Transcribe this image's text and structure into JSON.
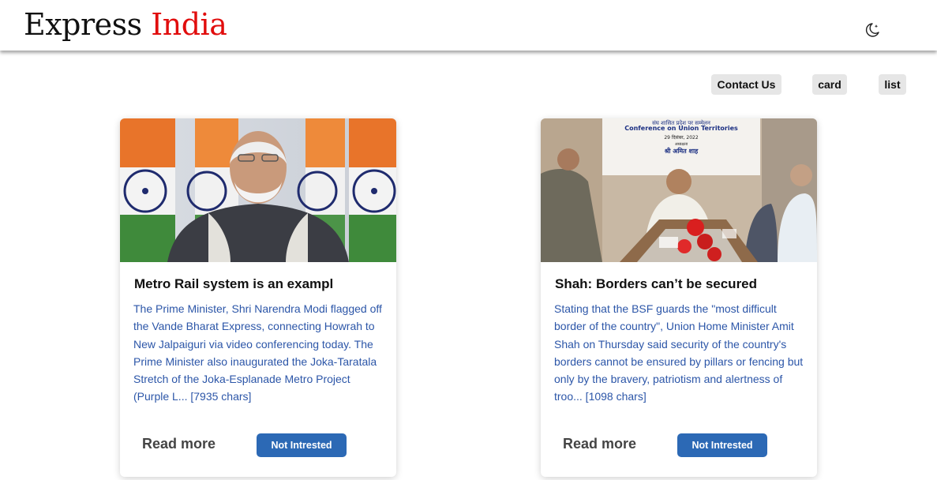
{
  "header": {
    "brand_main": "Express",
    "brand_accent": "India",
    "theme_toggle_icon": "moon-star-icon"
  },
  "nav": {
    "contact_label": "Contact Us",
    "card_label": "card",
    "list_label": "list"
  },
  "cards": [
    {
      "title": "Metro Rail system is an exampl",
      "description": "The Prime Minister, Shri Narendra Modi flagged off the Vande Bharat Express, connecting Howrah to New Jalpaiguri via video conferencing today. The Prime Minister also inaugurated the Joka-Taratala Stretch of the Joka-Esplanade Metro Project (Purple L... [7935 chars]",
      "read_more": "Read more",
      "not_interested": "Not Intrested"
    },
    {
      "title": "Shah: Borders can’t be secured",
      "description": "Stating that the BSF guards the \"most difficult border of the country\", Union Home Minister Amit Shah on Thursday said security of the country's borders cannot be ensured by pillars or fencing but only by the bravery, patriotism and alertness of troo... [1098 chars]",
      "read_more": "Read more",
      "not_interested": "Not Intrested",
      "image_banner": {
        "line1": "संघ शासित प्रदेश पर सम्मेलन",
        "line2": "Conference on Union Territories",
        "line3": "29 दिसंबर, 2022",
        "line4": "अध्यक्षता",
        "line5": "श्री अमित शाह"
      }
    }
  ],
  "colors": {
    "brand_accent": "#e10d0d",
    "link_blue": "#2c56a8",
    "button_blue": "#2c69b5"
  }
}
